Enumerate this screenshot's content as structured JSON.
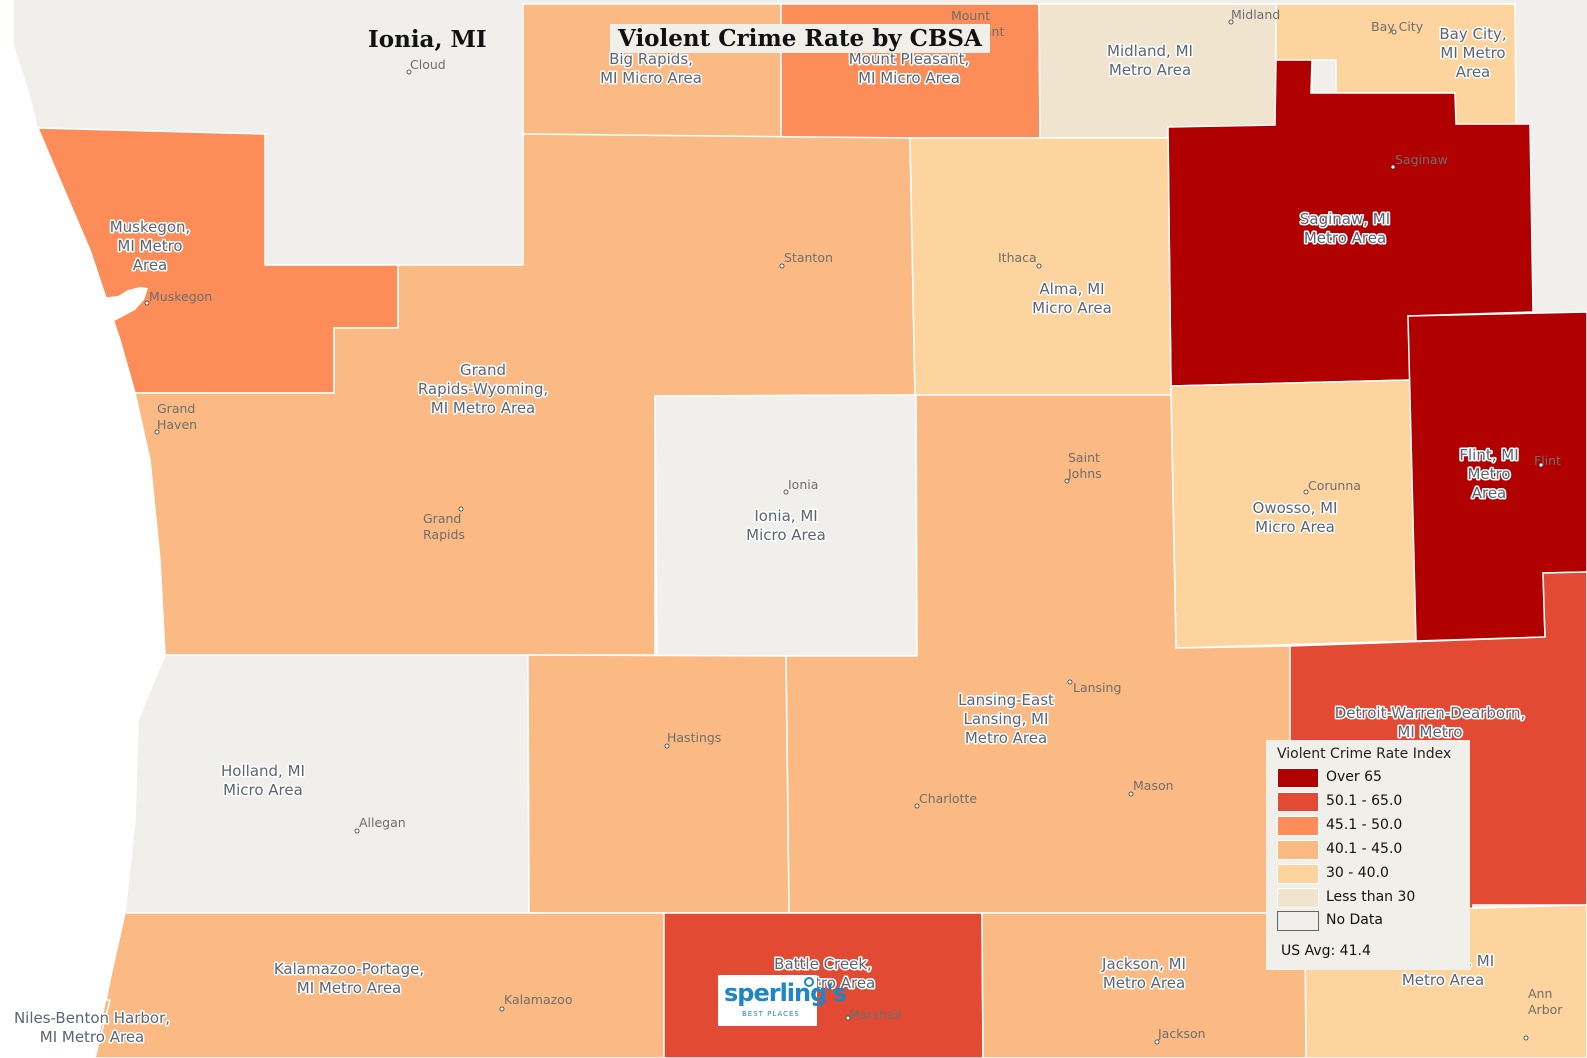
{
  "header": {
    "location_title": "Ionia, MI",
    "map_title": "Violent Crime Rate by CBSA"
  },
  "legend": {
    "title": "Violent Crime Rate Index",
    "items": [
      {
        "label": "Over 65",
        "color": "#b10000",
        "class": "over-65"
      },
      {
        "label": "50.1 - 65.0",
        "color": "#e34a33",
        "class": "50-65"
      },
      {
        "label": "45.1 - 50.0",
        "color": "#fc8d59",
        "class": "45-50"
      },
      {
        "label": "40.1 - 45.0",
        "color": "#fbba83",
        "class": "40-45"
      },
      {
        "label": "30 - 40.0",
        "color": "#fdd49e",
        "class": "30-40"
      },
      {
        "label": "Less than 30",
        "color": "#f1e4cf",
        "class": "lt-30"
      },
      {
        "label": "No Data",
        "color": "#f0efeb",
        "class": "no-data"
      }
    ],
    "us_avg": "US Avg: 41.4"
  },
  "areas": [
    {
      "name": "Muskegon, MI Metro Area",
      "label_lines": [
        "Muskegon,",
        "MI Metro",
        "Area"
      ],
      "class": "45-50"
    },
    {
      "name": "Big Rapids, MI Micro Area",
      "label_lines": [
        "Big Rapids,",
        "MI Micro Area"
      ],
      "class": "40-45"
    },
    {
      "name": "Mount Pleasant, MI Micro Area",
      "label_lines": [
        "Mount Pleasant,",
        "MI Micro Area"
      ],
      "class": "45-50"
    },
    {
      "name": "Midland, MI Metro Area",
      "label_lines": [
        "Midland, MI",
        "Metro Area"
      ],
      "class": "lt-30"
    },
    {
      "name": "Bay City, MI Metro Area",
      "label_lines": [
        "Bay City,",
        "MI Metro",
        "Area"
      ],
      "class": "30-40"
    },
    {
      "name": "Saginaw, MI Metro Area",
      "label_lines": [
        "Saginaw, MI",
        "Metro Area"
      ],
      "class": "over-65"
    },
    {
      "name": "Grand Rapids-Wyoming, MI Metro Area",
      "label_lines": [
        "Grand",
        "Rapids-Wyoming,",
        "MI Metro Area"
      ],
      "class": "40-45"
    },
    {
      "name": "Alma, MI Micro Area",
      "label_lines": [
        "Alma, MI",
        "Micro Area"
      ],
      "class": "30-40"
    },
    {
      "name": "Ionia, MI Micro Area",
      "label_lines": [
        "Ionia, MI",
        "Micro Area"
      ],
      "class": "no-data"
    },
    {
      "name": "Owosso, MI Micro Area",
      "label_lines": [
        "Owosso, MI",
        "Micro Area"
      ],
      "class": "30-40"
    },
    {
      "name": "Flint, MI Metro Area",
      "label_lines": [
        "Flint, MI",
        "Metro",
        "Area"
      ],
      "class": "over-65"
    },
    {
      "name": "Holland, MI Micro Area",
      "label_lines": [
        "Holland, MI",
        "Micro Area"
      ],
      "class": "no-data"
    },
    {
      "name": "Lansing-East Lansing, MI Metro Area",
      "label_lines": [
        "Lansing-East",
        "Lansing, MI",
        "Metro Area"
      ],
      "class": "40-45"
    },
    {
      "name": "Detroit-Warren-Dearborn, MI Metro",
      "label_lines": [
        "Detroit-Warren-Dearborn,",
        "MI Metro"
      ],
      "class": "50-65"
    },
    {
      "name": "Kalamazoo-Portage, MI Metro Area",
      "label_lines": [
        "Kalamazoo-Portage,",
        "MI Metro Area"
      ],
      "class": "40-45"
    },
    {
      "name": "Battle Creek, MI Metro Area",
      "label_lines": [
        "Battle Creek,",
        "MI Metro Area"
      ],
      "class": "50-65"
    },
    {
      "name": "Jackson, MI Metro Area",
      "label_lines": [
        "Jackson, MI",
        "Metro Area"
      ],
      "class": "40-45"
    },
    {
      "name": "Ann Arbor, MI Metro Area",
      "label_lines": [
        "Ann Arbor, MI",
        "Metro Area"
      ],
      "class": "30-40"
    },
    {
      "name": "Niles-Benton Harbor, MI Metro Area",
      "label_lines": [
        "Niles-Benton Harbor,",
        "MI Metro Area"
      ],
      "class": "40-45"
    }
  ],
  "cities": [
    "Cloud",
    "Mount Pleasant",
    "Midland",
    "Bay City",
    "Saginaw",
    "Muskegon",
    "Stanton",
    "Ithaca",
    "Grand Haven",
    "Ionia",
    "Saint Johns",
    "Corunna",
    "Flint",
    "Grand Rapids",
    "Lansing",
    "Hastings",
    "Allegan",
    "Charlotte",
    "Mason",
    "Kalamazoo",
    "Marshall",
    "Jackson",
    "Ann Arbor"
  ],
  "logo": {
    "brand": "sperling's",
    "tagline": "BEST PLACES"
  }
}
